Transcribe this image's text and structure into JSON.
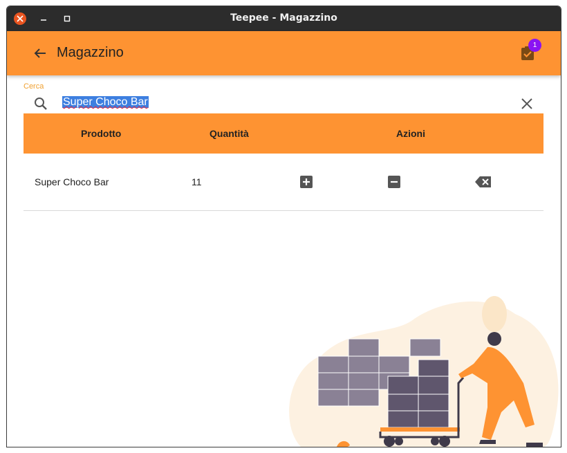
{
  "window": {
    "title": "Teepee - Magazzino"
  },
  "appbar": {
    "title": "Magazzino",
    "cart_badge": "1"
  },
  "search": {
    "label": "Cerca",
    "value": "Super Choco Bar"
  },
  "table": {
    "headers": {
      "product": "Prodotto",
      "quantity": "Quantità",
      "actions": "Azioni"
    },
    "rows": [
      {
        "product": "Super Choco Bar",
        "quantity": "11"
      }
    ]
  },
  "colors": {
    "accent": "#fe9332",
    "badge": "#8a13f2",
    "label": "#f0a030"
  },
  "icons": {
    "back": "arrow-left-icon",
    "cart": "clipboard-check-icon",
    "search": "search-icon",
    "clear": "close-icon",
    "add": "plus-box-icon",
    "remove": "minus-box-icon",
    "delete": "backspace-icon"
  }
}
